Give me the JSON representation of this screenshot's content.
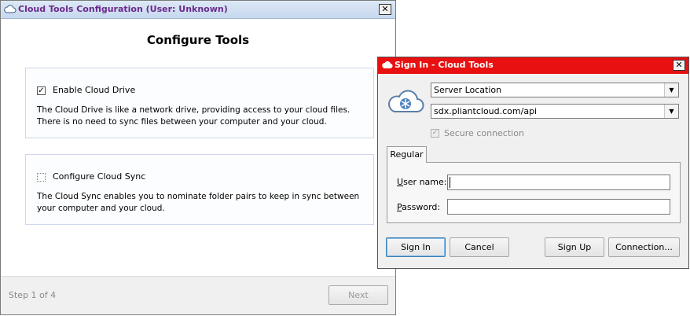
{
  "main_window": {
    "title": "Cloud Tools Configuration (User: Unknown)",
    "close_glyph": "✕",
    "heading": "Configure Tools",
    "options": [
      {
        "label": "Enable Cloud Drive",
        "checked": true,
        "description": "The Cloud Drive is like a network drive, providing access to your cloud files. There is no need to sync files between your computer and your cloud."
      },
      {
        "label": "Configure Cloud Sync",
        "checked": false,
        "description": "The Cloud Sync enables you to nominate folder pairs to keep in sync between your computer and your cloud."
      }
    ],
    "step_text": "Step 1 of 4",
    "next_label": "Next"
  },
  "signin_dialog": {
    "title": "Sign In - Cloud Tools",
    "close_glyph": "✕",
    "location_select": "Server Location",
    "server_select": "sdx.pliantcloud.com/api",
    "secure_label": "Secure connection",
    "secure_checked": true,
    "tab_label": "Regular",
    "username_label_u": "U",
    "username_label_rest": "ser name:",
    "username_value": "",
    "password_label_u": "P",
    "password_label_rest": "assword:",
    "password_value": "",
    "buttons": {
      "sign_in": "Sign In",
      "cancel": "Cancel",
      "sign_up": "Sign Up",
      "connection": "Connection..."
    }
  },
  "colors": {
    "dialog_titlebar": "#e81010",
    "main_title_text": "#6a2a8a"
  },
  "icons": [
    "cloud-icon",
    "close-icon",
    "checkbox-checked-icon",
    "dropdown-arrow-icon"
  ]
}
